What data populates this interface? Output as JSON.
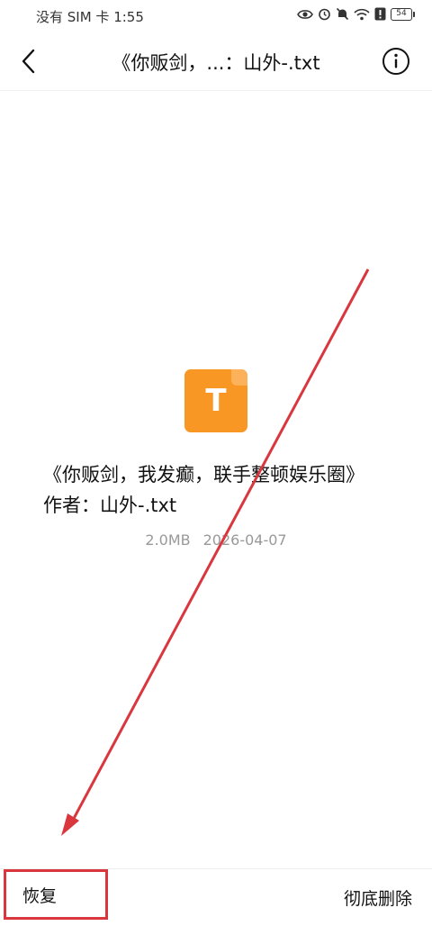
{
  "status_bar": {
    "text": "没有 SIM 卡 1:55",
    "battery_level": "54"
  },
  "header": {
    "title": "《你贩剑，...：山外-.txt",
    "back_icon": "chevron-left-icon",
    "info_icon": "info-circle-icon"
  },
  "file": {
    "icon_letter": "T",
    "icon_color": "#F89723",
    "name": "《你贩剑，我发癫，联手整顿娱乐圈》作者：山外-.txt",
    "size": "2.0MB",
    "date": "2026-04-07"
  },
  "actions": {
    "restore_label": "恢复",
    "delete_label": "彻底删除"
  },
  "annotation": {
    "color": "#D9363E"
  }
}
